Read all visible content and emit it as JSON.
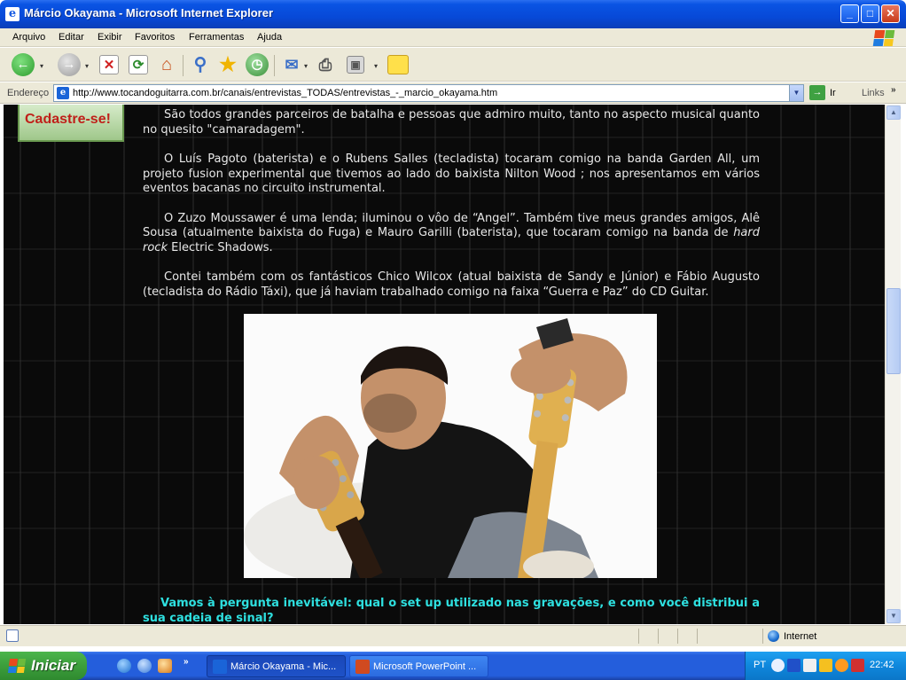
{
  "window": {
    "title": "Márcio Okayama - Microsoft Internet Explorer"
  },
  "menu": [
    "Arquivo",
    "Editar",
    "Exibir",
    "Favoritos",
    "Ferramentas",
    "Ajuda"
  ],
  "toolbar": {
    "icons": [
      "back-icon",
      "forward-icon",
      "stop-icon",
      "refresh-icon",
      "home-icon",
      "search-icon",
      "favorites-icon",
      "history-icon",
      "mail-icon",
      "print-icon",
      "edit-icon",
      "notes-icon"
    ]
  },
  "address": {
    "label": "Endereço",
    "url": "http://www.tocandoguitarra.com.br/canais/entrevistas_TODAS/entrevistas_-_marcio_okayama.htm",
    "go_label": "Ir",
    "links_label": "Links"
  },
  "page": {
    "cadastre_label": "Cadastre-se!",
    "paragraphs": [
      "São todos grandes parceiros de batalha e pessoas que admiro muito, tanto no aspecto musical quanto no quesito \"camaradagem\".",
      "O Luís Pagoto (baterista) e o Rubens Salles (tecladista) tocaram comigo na banda Garden All, um projeto fusion experimental que tivemos ao lado do baixista Nilton Wood ; nos apresentamos em vários eventos bacanas no circuito instrumental.",
      "Contei também com os fantásticos Chico Wilcox (atual baixista de Sandy e Júnior) e Fábio Augusto (tecladista do Rádio Táxi), que já haviam trabalhado comigo na faixa “Guerra e Paz” do CD Guitar."
    ],
    "paragraph3_pre": "O Zuzo Moussawer é uma lenda; iluminou o vôo de “Angel”. Também tive meus grandes amigos, Alê Sousa (atualmente baixista do Fuga) e Mauro Garilli (baterista), que tocaram comigo na banda de ",
    "paragraph3_em": "hard rock",
    "paragraph3_post": " Electric Shadows.",
    "question": "Vamos à pergunta inevitável: qual o set up utilizado nas gravações, e como você distribui a sua cadeia de sinal?"
  },
  "status": {
    "zone": "Internet"
  },
  "taskbar": {
    "start_label": "Iniciar",
    "tasks": [
      "Márcio Okayama - Mic...",
      "Microsoft PowerPoint ..."
    ],
    "lang": "PT",
    "clock": "22:42"
  },
  "colors": {
    "xp_blue": "#0a54e3",
    "question_cyan": "#2ee0e0",
    "cadastre_red": "#c0201a"
  }
}
